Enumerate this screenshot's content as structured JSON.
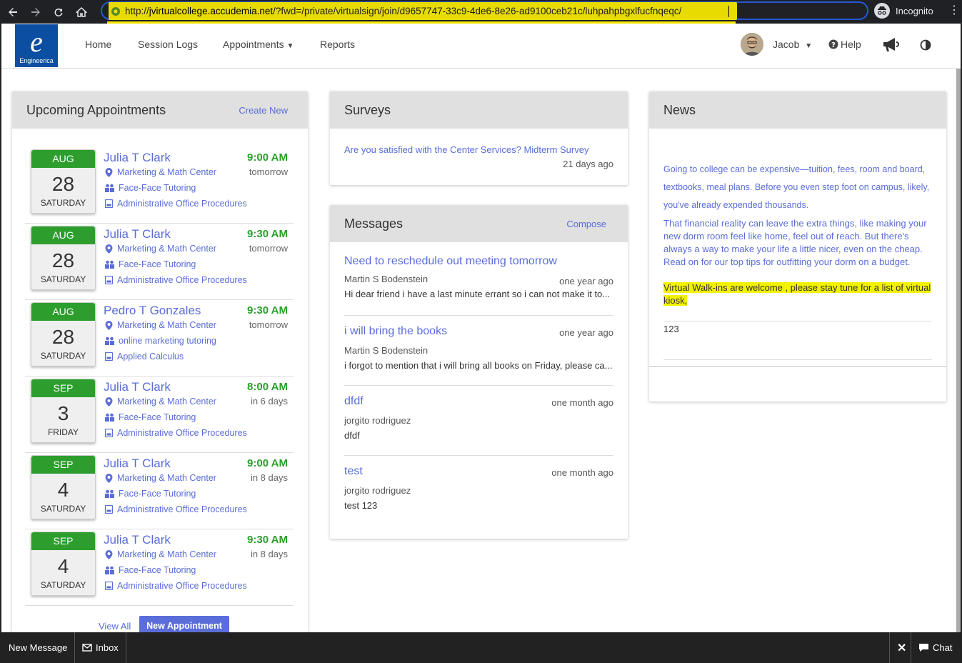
{
  "browser": {
    "url_prefix": "http://",
    "url_host": "jvirtualcollege.accudemia.net",
    "url_path": "/?fwd=/private/virtualsign/join/d9657747-33c9-4de6-8e26-ad9100ceb21c/luhpahpbgxlfucfnqeqc/",
    "mode_label": "Incognito"
  },
  "nav": {
    "logo_text": "Engineerica",
    "logo_letter": "e",
    "links": [
      "Home",
      "Session Logs",
      "Appointments",
      "Reports"
    ],
    "user_name": "Jacob",
    "help_label": "Help"
  },
  "appointments": {
    "title": "Upcoming Appointments",
    "create_label": "Create New",
    "view_all_label": "View All",
    "new_label": "New Appointment",
    "items": [
      {
        "month": "AUG",
        "day": "28",
        "weekday": "SATURDAY",
        "name": "Julia T Clark",
        "time": "9:00 AM",
        "when": "tomorrow",
        "center": "Marketing & Math Center",
        "service": "Face-Face Tutoring",
        "course": "Administrative Office Procedures"
      },
      {
        "month": "AUG",
        "day": "28",
        "weekday": "SATURDAY",
        "name": "Julia T Clark",
        "time": "9:30 AM",
        "when": "tomorrow",
        "center": "Marketing & Math Center",
        "service": "Face-Face Tutoring",
        "course": "Administrative Office Procedures"
      },
      {
        "month": "AUG",
        "day": "28",
        "weekday": "SATURDAY",
        "name": "Pedro T Gonzales",
        "time": "9:30 AM",
        "when": "tomorrow",
        "center": "Marketing & Math Center",
        "service": "online marketing tutoring",
        "course": "Applied Calculus"
      },
      {
        "month": "SEP",
        "day": "3",
        "weekday": "FRIDAY",
        "name": "Julia T Clark",
        "time": "8:00 AM",
        "when": "in 6 days",
        "center": "Marketing & Math Center",
        "service": "Face-Face Tutoring",
        "course": "Administrative Office Procedures"
      },
      {
        "month": "SEP",
        "day": "4",
        "weekday": "SATURDAY",
        "name": "Julia T Clark",
        "time": "9:00 AM",
        "when": "in 8 days",
        "center": "Marketing & Math Center",
        "service": "Face-Face Tutoring",
        "course": "Administrative Office Procedures"
      },
      {
        "month": "SEP",
        "day": "4",
        "weekday": "SATURDAY",
        "name": "Julia T Clark",
        "time": "9:30 AM",
        "when": "in 8 days",
        "center": "Marketing & Math Center",
        "service": "Face-Face Tutoring",
        "course": "Administrative Office Procedures"
      }
    ]
  },
  "surveys": {
    "title": "Surveys",
    "item_label": "Are you satisfied with the Center Services? Midterm Survey",
    "item_ago": "21 days ago"
  },
  "messages": {
    "title": "Messages",
    "compose_label": "Compose",
    "items": [
      {
        "subject": "Need to reschedule out meeting tomorrow",
        "from": "Martin S Bodenstein",
        "ago": "one year ago",
        "body": "Hi dear friend i have a last minute errant so i can not make it to..."
      },
      {
        "subject": "i will bring the books",
        "from": "Martin S Bodenstein",
        "ago": "one year ago",
        "body": "i forgot to mention that i will bring all books on Friday, please ca..."
      },
      {
        "subject": "dfdf",
        "from": "jorgito rodriguez",
        "ago": "one month ago",
        "body": "dfdf"
      },
      {
        "subject": "test",
        "from": "jorgito rodriguez",
        "ago": "one month ago",
        "body": "test 123"
      }
    ]
  },
  "news": {
    "title": "News",
    "para1": "Going to college can be expensive—tuition, fees, room and board, textbooks, meal plans. Before you even step foot on campus, likely, you've already expended thousands.",
    "para2": "That financial reality can leave the extra things, like making your new dorm room feel like home, feel out of reach. But there's always a way to make your life a little nicer, even on the cheap. Read on for our top tips for outfitting your dorm on a budget.",
    "highlight": "Virtual Walk-ins are welcome , please stay tune for a list of virtual kiosk,",
    "item2": "123"
  },
  "bottom": {
    "new_message": "New Message",
    "inbox": "Inbox",
    "chat": "Chat"
  }
}
